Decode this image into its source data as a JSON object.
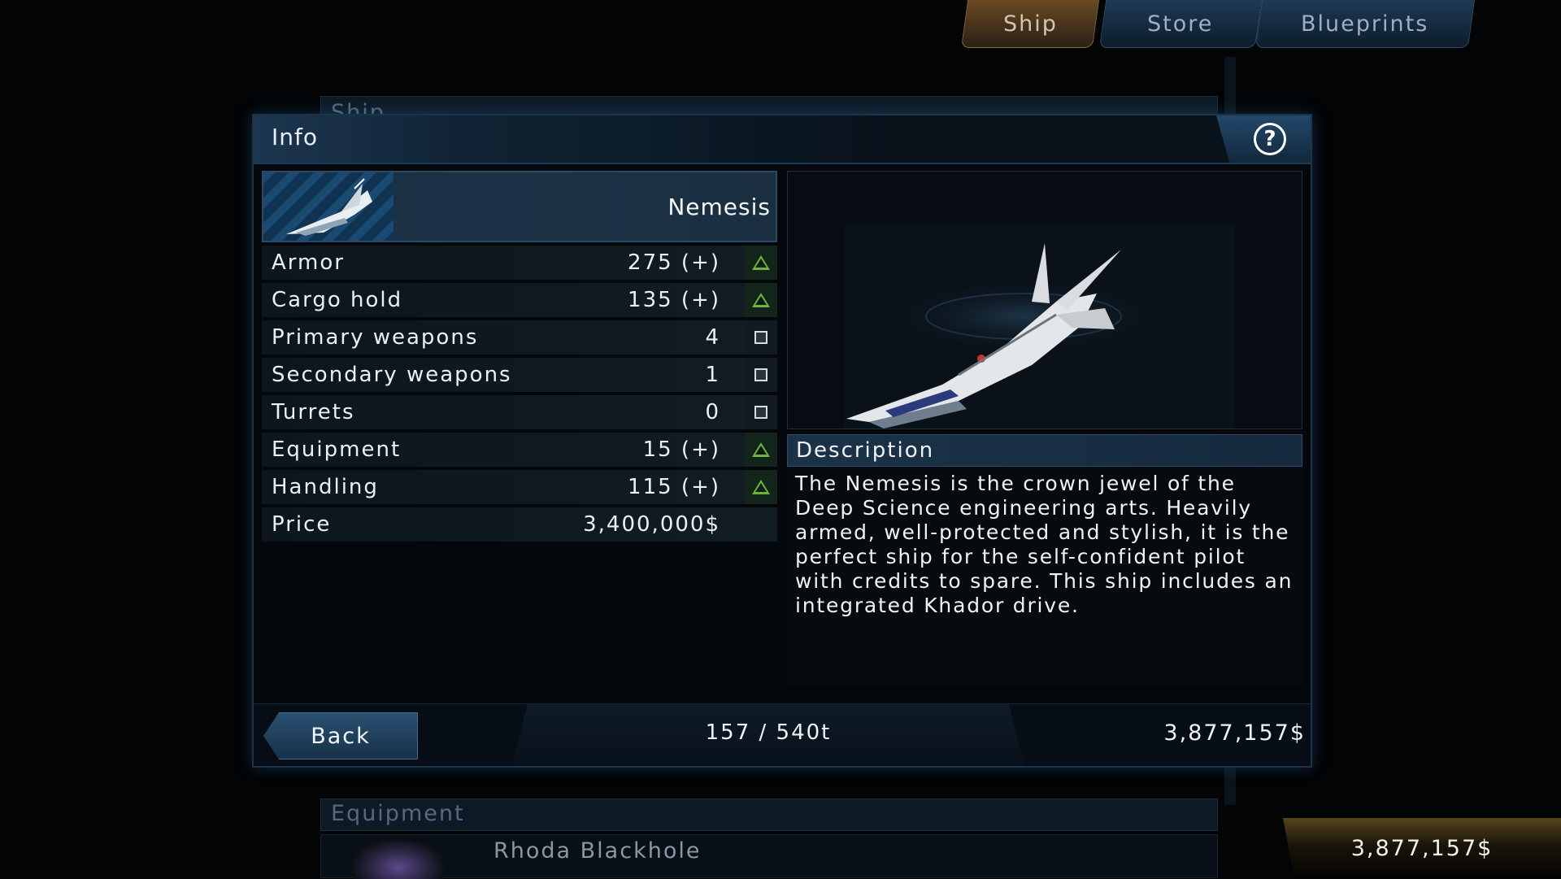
{
  "tabs": [
    {
      "label": "Ship",
      "active": true
    },
    {
      "label": "Store",
      "active": false
    },
    {
      "label": "Blueprints",
      "active": false
    }
  ],
  "background": {
    "ship_section_label": "Ship",
    "equipment_section_label": "Equipment",
    "equipment_item_name": "Rhoda Blackhole"
  },
  "dialog": {
    "title": "Info",
    "help_icon": "question-icon",
    "ship_name": "Nemesis",
    "stats": [
      {
        "label": "Armor",
        "value": "275 (+)",
        "indicator": "up"
      },
      {
        "label": "Cargo hold",
        "value": "135 (+)",
        "indicator": "up"
      },
      {
        "label": "Primary weapons",
        "value": "4",
        "indicator": "neutral"
      },
      {
        "label": "Secondary weapons",
        "value": "1",
        "indicator": "neutral"
      },
      {
        "label": "Turrets",
        "value": "0",
        "indicator": "neutral"
      },
      {
        "label": "Equipment",
        "value": "15 (+)",
        "indicator": "up"
      },
      {
        "label": "Handling",
        "value": "115 (+)",
        "indicator": "up"
      },
      {
        "label": "Price",
        "value": "3,400,000$",
        "indicator": "none"
      }
    ],
    "description_header": "Description",
    "description_text": "The Nemesis is the crown jewel of the Deep Science engineering arts. Heavily armed, well-protected and stylish, it is the perfect ship for the self-confident pilot with credits to spare. This ship includes an integrated Khador drive.",
    "footer": {
      "back_label": "Back",
      "cargo": "157 / 540t",
      "credits": "3,877,157$"
    }
  },
  "wallet": "3,877,157$",
  "colors": {
    "accent": "#2a4b66",
    "active_tab": "#8a6a38",
    "stat_up": "#6fb33d"
  }
}
